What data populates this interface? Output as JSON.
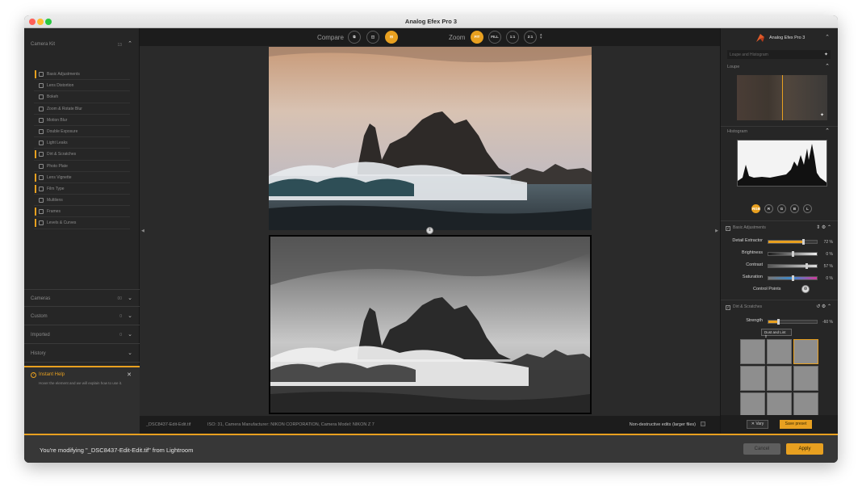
{
  "window": {
    "title": "Analog Efex Pro 3"
  },
  "left_panel": {
    "camera_kit": {
      "label": "Camera Kit",
      "count": "13"
    },
    "tools": [
      {
        "label": "Basic Adjustments",
        "active": true
      },
      {
        "label": "Lens Distortion",
        "active": false
      },
      {
        "label": "Bokeh",
        "active": false
      },
      {
        "label": "Zoom & Rotate Blur",
        "active": false
      },
      {
        "label": "Motion Blur",
        "active": false
      },
      {
        "label": "Double Exposure",
        "active": false
      },
      {
        "label": "Light Leaks",
        "active": false
      },
      {
        "label": "Dirt & Scratches",
        "active": true
      },
      {
        "label": "Photo Plate",
        "active": false
      },
      {
        "label": "Lens Vignette",
        "active": true
      },
      {
        "label": "Film Type",
        "active": true
      },
      {
        "label": "Multilens",
        "active": false
      },
      {
        "label": "Frames",
        "active": true
      },
      {
        "label": "Levels & Curves",
        "active": true
      }
    ],
    "sections": {
      "cameras": {
        "label": "Cameras",
        "count": "00"
      },
      "custom": {
        "label": "Custom",
        "count": "0"
      },
      "imported": {
        "label": "Imported",
        "count": "0"
      },
      "history": {
        "label": "History"
      }
    },
    "help": {
      "title": "Instant Help",
      "text": "Hover the element and we will explain how to use it."
    }
  },
  "toolbar": {
    "compare_label": "Compare",
    "zoom_label": "Zoom",
    "zoom_fit": "FIT",
    "zoom_fill": "FILL",
    "zoom_1_1": "1:1",
    "zoom_2_1": "2:1"
  },
  "status_bar": {
    "filename": "_DSC8437-Edit-Edit.tif",
    "metadata": "ISO: 31, Camera Manufacturer: NIKON CORPORATION, Camera Model: NIKON Z 7",
    "nondestructive_label": "Non-destructive edits (larger files)"
  },
  "right_panel": {
    "brand": "Analog Efex Pro 3",
    "loupe_field": "Loupe and Histogram",
    "loupe_header": "Loupe",
    "histogram_header": "Histogram",
    "channels": [
      "RGB",
      "R",
      "G",
      "B",
      "L"
    ],
    "basic_adjustments": {
      "title": "Basic Adjustments",
      "sliders": [
        {
          "label": "Detail Extractor",
          "value": "72 %",
          "fraction": 0.72
        },
        {
          "label": "Brightness",
          "value": "0 %",
          "fraction": 0.5
        },
        {
          "label": "Contrast",
          "value": "57 %",
          "fraction": 0.78
        },
        {
          "label": "Saturation",
          "value": "0 %",
          "fraction": 0.5
        }
      ],
      "control_points_label": "Control Points"
    },
    "dirt_scratches": {
      "title": "Dirt & Scratches",
      "strength_label": "Strength",
      "strength_value": "-60 %",
      "strength_fraction": 0.2,
      "dropdown_value": "Dust and Lint"
    },
    "vary_label": "Vary",
    "save_preset_label": "Save preset"
  },
  "footer": {
    "message": "You're modifying \"_DSC8437-Edit-Edit.tif\" from Lightroom",
    "cancel_label": "Cancel",
    "apply_label": "Apply"
  },
  "colors": {
    "accent": "#e8a020"
  }
}
